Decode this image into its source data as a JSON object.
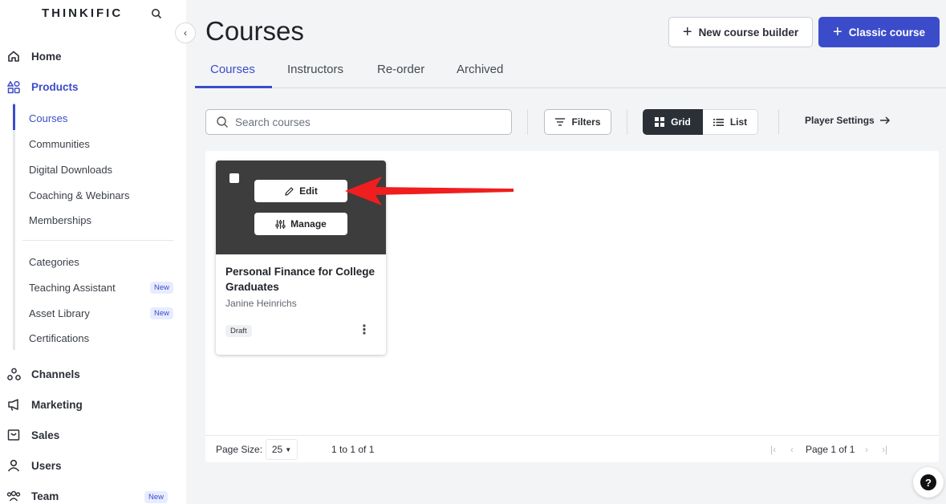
{
  "brand": {
    "name": "THINKIFIC"
  },
  "sidebar": {
    "main": [
      {
        "label": "Home",
        "icon": "home-icon"
      },
      {
        "label": "Products",
        "icon": "products-icon",
        "active": true
      },
      {
        "label": "Channels",
        "icon": "channels-icon"
      },
      {
        "label": "Marketing",
        "icon": "marketing-icon"
      },
      {
        "label": "Sales",
        "icon": "sales-icon"
      },
      {
        "label": "Users",
        "icon": "users-icon"
      },
      {
        "label": "Team",
        "icon": "team-icon",
        "badge": "New"
      }
    ],
    "products_sub": [
      {
        "label": "Courses",
        "active": true
      },
      {
        "label": "Communities"
      },
      {
        "label": "Digital Downloads"
      },
      {
        "label": "Coaching & Webinars"
      },
      {
        "label": "Memberships"
      },
      {
        "label": "Categories"
      },
      {
        "label": "Teaching Assistant",
        "badge": "New"
      },
      {
        "label": "Asset Library",
        "badge": "New"
      },
      {
        "label": "Certifications"
      }
    ]
  },
  "header": {
    "title": "Courses",
    "new_course_builder": "New course builder",
    "classic_course": "Classic course"
  },
  "tabs": [
    {
      "label": "Courses",
      "active": true
    },
    {
      "label": "Instructors"
    },
    {
      "label": "Re-order"
    },
    {
      "label": "Archived"
    }
  ],
  "toolbar": {
    "search_placeholder": "Search courses",
    "filters": "Filters",
    "grid": "Grid",
    "list": "List",
    "player_settings": "Player Settings"
  },
  "course_card": {
    "edit": "Edit",
    "manage": "Manage",
    "title": "Personal Finance for College Graduates",
    "author": "Janine Heinrichs",
    "status": "Draft"
  },
  "footer": {
    "page_size_label": "Page Size:",
    "page_size_value": "25",
    "range": "1 to 1 of 1",
    "page": "Page 1 of 1"
  },
  "colors": {
    "accent": "#3b4cca",
    "dark": "#2b2f36",
    "arrow": "#f01e1e"
  }
}
